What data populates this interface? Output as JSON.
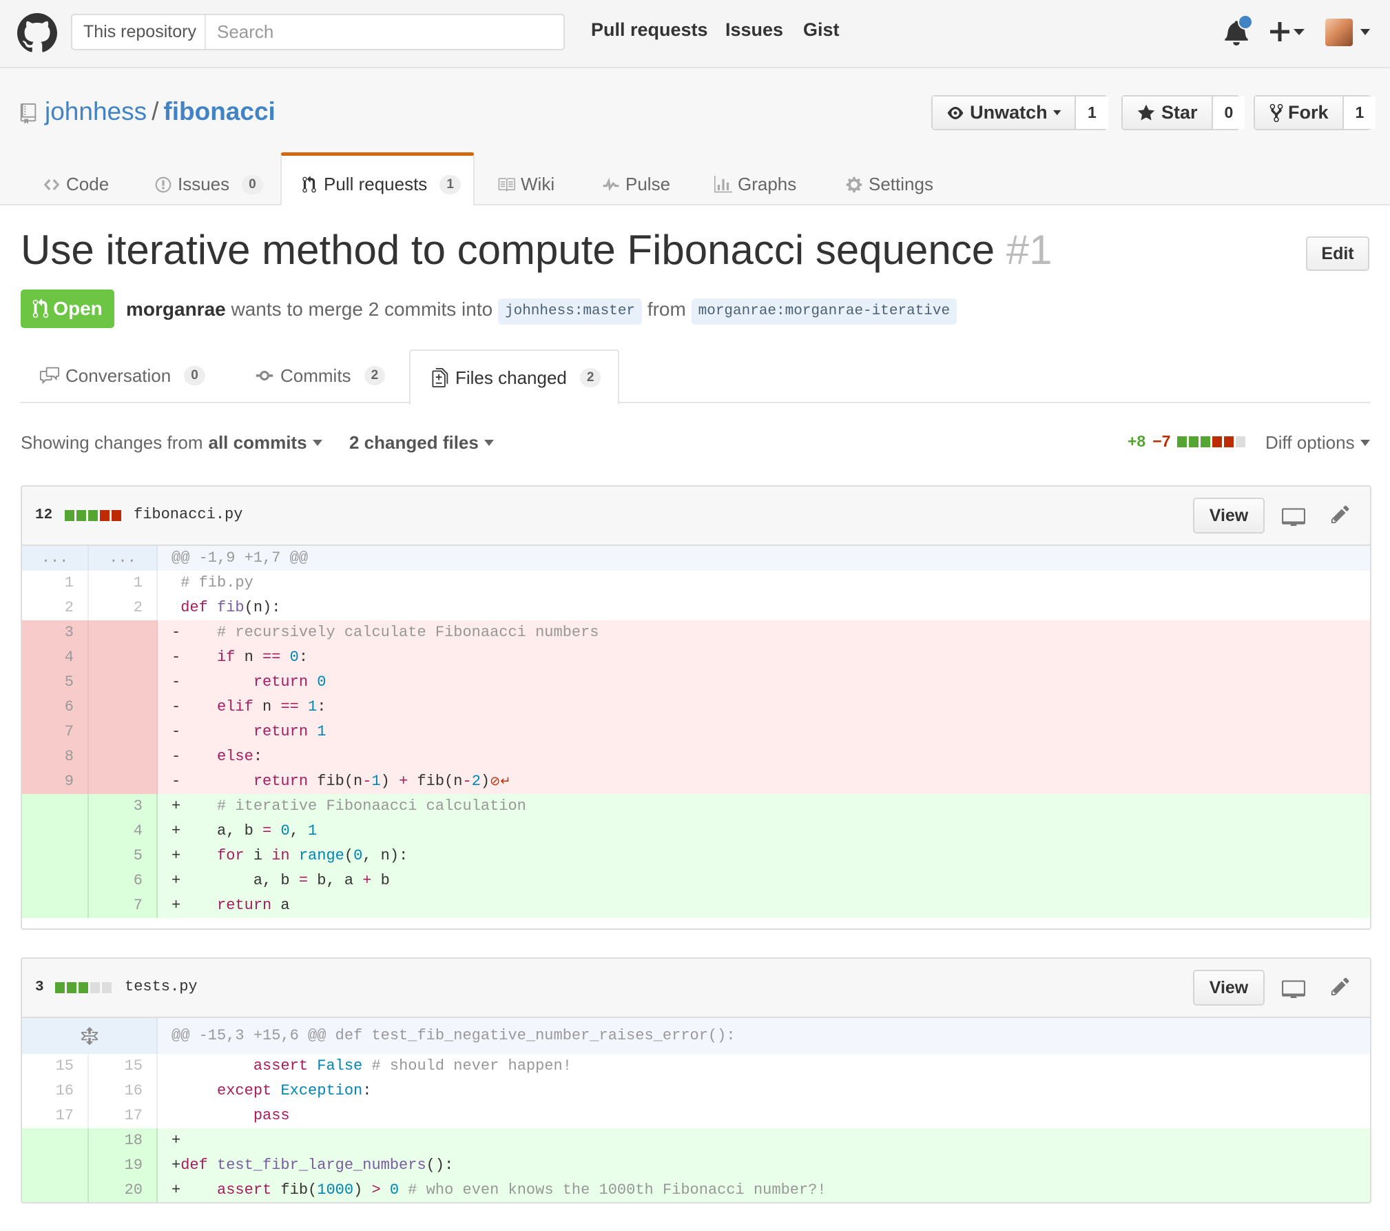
{
  "header": {
    "search_scope": "This repository",
    "search_placeholder": "Search",
    "nav": [
      "Pull requests",
      "Issues",
      "Gist"
    ]
  },
  "repo": {
    "owner": "johnhess",
    "separator": "/",
    "name": "fibonacci",
    "unwatch_label": "Unwatch",
    "watch_count": "1",
    "star_label": "Star",
    "star_count": "0",
    "fork_label": "Fork",
    "fork_count": "1",
    "nav": {
      "code": "Code",
      "issues": "Issues",
      "issues_count": "0",
      "pulls": "Pull requests",
      "pulls_count": "1",
      "wiki": "Wiki",
      "pulse": "Pulse",
      "graphs": "Graphs",
      "settings": "Settings"
    }
  },
  "pr": {
    "title": "Use iterative method to compute Fibonacci sequence",
    "number": "#1",
    "edit_label": "Edit",
    "state": "Open",
    "author": "morganrae",
    "merge_text": "wants to merge 2 commits into",
    "base_owner": "johnhess",
    "base_branch": "master",
    "from_text": "from",
    "head_owner": "morganrae",
    "head_branch": "morganrae-iterative",
    "tabs": {
      "conversation": "Conversation",
      "conversation_count": "0",
      "commits": "Commits",
      "commits_count": "2",
      "files": "Files changed",
      "files_count": "2"
    }
  },
  "toolbar": {
    "showing_prefix": "Showing changes from",
    "showing_value": "all commits",
    "changed_files": "2 changed files",
    "additions": "+8",
    "deletions": "−7",
    "diff_options": "Diff options"
  },
  "files": [
    {
      "changes": "12",
      "name": "fibonacci.py",
      "view_label": "View",
      "hunk": "@@ -1,9 +1,7 @@"
    },
    {
      "changes": "3",
      "name": "tests.py",
      "view_label": "View",
      "hunk": "@@ -15,3 +15,6 @@ def test_fib_negative_number_raises_error():"
    }
  ],
  "colors": {
    "accent": "#4183c4",
    "open_green": "#6cc644",
    "addition": "#55a532",
    "deletion": "#bd2c00",
    "tab_active_border": "#d26911"
  },
  "icons": [
    "github-logo-icon",
    "bell-icon",
    "plus-icon",
    "repo-icon",
    "eye-icon",
    "star-icon",
    "fork-icon",
    "code-icon",
    "issue-icon",
    "pull-request-icon",
    "wiki-icon",
    "pulse-icon",
    "graph-icon",
    "gear-icon",
    "comment-icon",
    "commit-icon",
    "file-diff-icon",
    "desktop-icon",
    "pencil-icon",
    "unfold-icon",
    "no-newline-icon"
  ]
}
